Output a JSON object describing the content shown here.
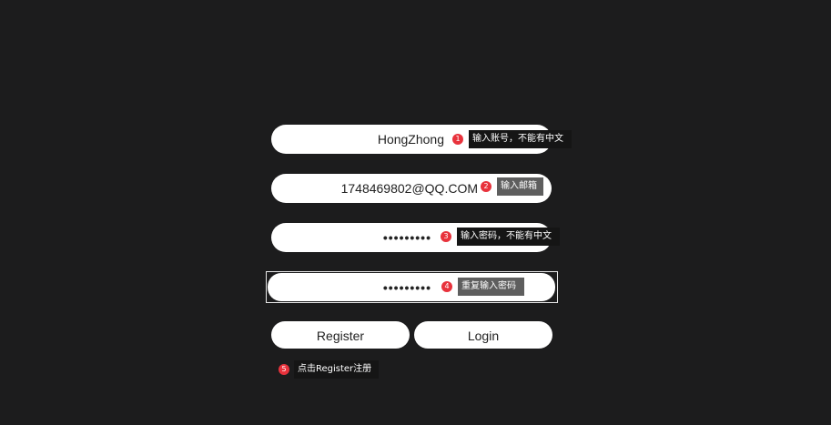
{
  "form": {
    "username": {
      "value": "HongZhong",
      "badge": "1",
      "tip": "输入账号，不能有中文"
    },
    "email": {
      "value": "1748469802@QQ.COM",
      "badge": "2",
      "tip": "输入邮箱"
    },
    "password": {
      "value": "•••••••••",
      "badge": "3",
      "tip": "输入密码，不能有中文"
    },
    "confirm_password": {
      "value": "•••••••••",
      "badge": "4",
      "tip": "重复输入密码"
    }
  },
  "buttons": {
    "register_label": "Register",
    "login_label": "Login"
  },
  "hint": {
    "badge": "5",
    "tip": "点击Register注册"
  },
  "colors": {
    "background": "#1c1c1d",
    "field": "#ffffff",
    "badge": "#e8323c",
    "tip_dark": "#151515",
    "tip_grey": "#5e5e5e"
  }
}
